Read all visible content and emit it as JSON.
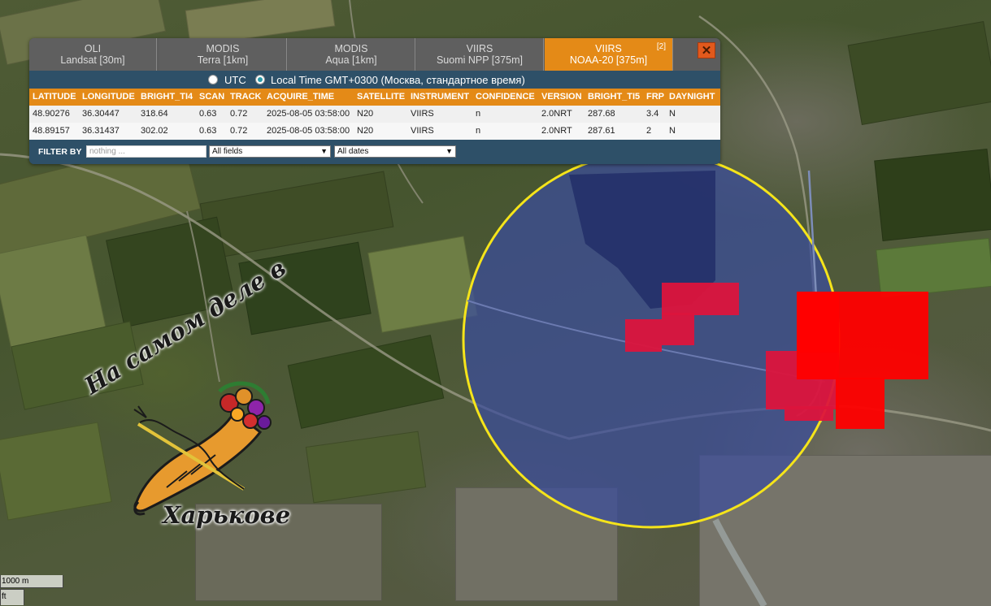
{
  "tabs": [
    {
      "line1": "OLI",
      "line2": "Landsat [30m]",
      "badge": ""
    },
    {
      "line1": "MODIS",
      "line2": "Terra [1km]",
      "badge": ""
    },
    {
      "line1": "MODIS",
      "line2": "Aqua [1km]",
      "badge": ""
    },
    {
      "line1": "VIIRS",
      "line2": "Suomi NPP [375m]",
      "badge": ""
    },
    {
      "line1": "VIIRS",
      "line2": "NOAA-20 [375m]",
      "badge": "[2]"
    }
  ],
  "close_label": "✕",
  "time": {
    "utc_label": "UTC",
    "local_label": "Local Time GMT+0300 (Москва, стандартное время)",
    "selected": "local"
  },
  "table": {
    "columns": [
      "LATITUDE",
      "LONGITUDE",
      "BRIGHT_TI4",
      "SCAN",
      "TRACK",
      "ACQUIRE_TIME",
      "SATELLITE",
      "INSTRUMENT",
      "CONFIDENCE",
      "VERSION",
      "BRIGHT_TI5",
      "FRP",
      "DAYNIGHT"
    ],
    "rows": [
      [
        "48.90276",
        "36.30447",
        "318.64",
        "0.63",
        "0.72",
        "2025-08-05 03:58:00",
        "N20",
        "VIIRS",
        "n",
        "2.0NRT",
        "287.68",
        "3.4",
        "N"
      ],
      [
        "48.89157",
        "36.31437",
        "302.02",
        "0.63",
        "0.72",
        "2025-08-05 03:58:00",
        "N20",
        "VIIRS",
        "n",
        "2.0NRT",
        "287.61",
        "2",
        "N"
      ]
    ]
  },
  "filter": {
    "label": "FILTER BY",
    "placeholder": "nothing ...",
    "field_select": "All fields",
    "date_select": "All dates"
  },
  "logo": {
    "top_text": "На самом деле в",
    "bottom_text": "Харькове"
  },
  "scale": {
    "metric": "1000 m",
    "imperial": "ft"
  },
  "colors": {
    "tab_active": "#e48a17",
    "panel_bg": "#2e5068",
    "circle": "#f5e41a",
    "hotspot": "#ff0000"
  }
}
